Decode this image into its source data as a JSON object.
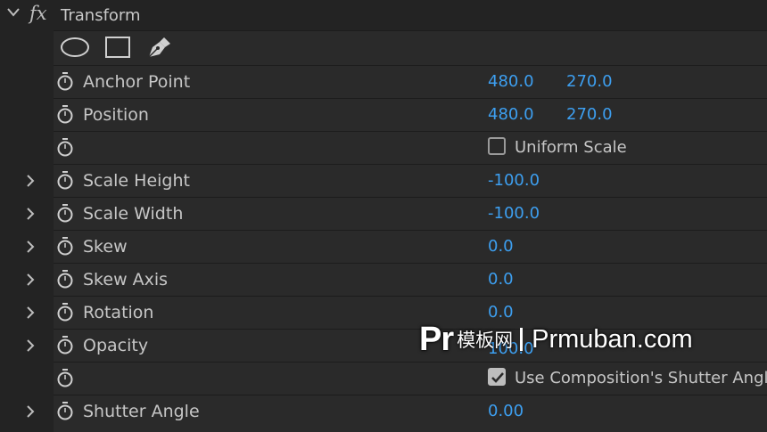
{
  "effect": {
    "icon": "fx-icon",
    "title": "Transform",
    "expanded": true
  },
  "mask_tools": [
    "ellipse-mask-icon",
    "rectangle-mask-icon",
    "pen-mask-icon"
  ],
  "properties": {
    "anchor_point": {
      "label": "Anchor Point",
      "x": "480.0",
      "y": "270.0"
    },
    "position": {
      "label": "Position",
      "x": "480.0",
      "y": "270.0"
    },
    "uniform_scale": {
      "label": "Uniform Scale",
      "checked": false
    },
    "scale_height": {
      "label": "Scale Height",
      "value": "-100.0"
    },
    "scale_width": {
      "label": "Scale Width",
      "value": "-100.0"
    },
    "skew": {
      "label": "Skew",
      "value": "0.0"
    },
    "skew_axis": {
      "label": "Skew Axis",
      "value": "0.0"
    },
    "rotation": {
      "label": "Rotation",
      "value": "0.0"
    },
    "opacity": {
      "label": "Opacity",
      "value": "100.0"
    },
    "use_comp_shutter": {
      "label": "Use Composition's Shutter Angle",
      "checked": true
    },
    "shutter_angle": {
      "label": "Shutter Angle",
      "value": "0.00"
    }
  },
  "watermark": {
    "logo": "Pr",
    "name_cn": "模板网",
    "site": "Prmuban.com"
  },
  "colors": {
    "background": "#232323",
    "row": "#2a2a2a",
    "value_blue": "#3d9ff0",
    "label": "#c6c6c6"
  }
}
